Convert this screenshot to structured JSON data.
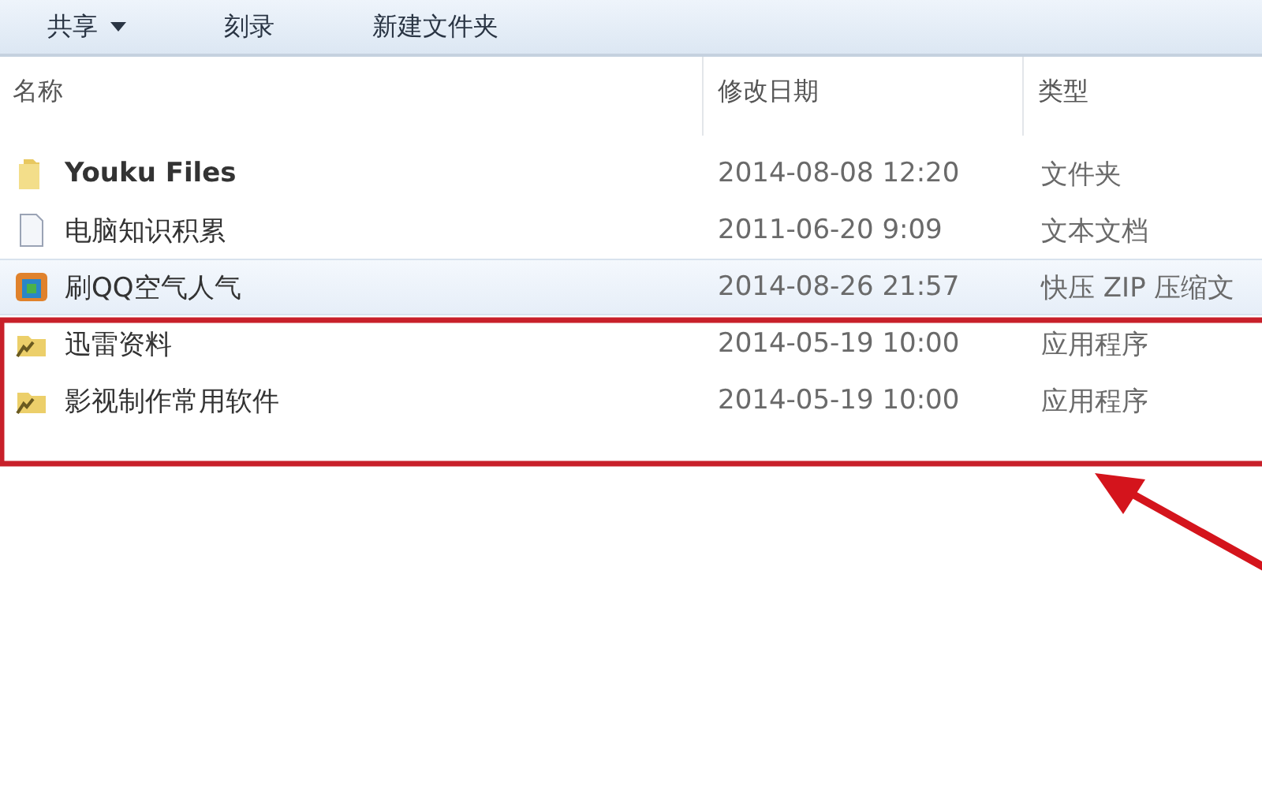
{
  "toolbar": [
    {
      "label": "共享",
      "has_menu": true
    },
    {
      "label": "刻录",
      "has_menu": false
    },
    {
      "label": "新建文件夹",
      "has_menu": false
    }
  ],
  "columns": [
    "名称",
    "修改日期",
    "类型"
  ],
  "rows": [
    {
      "kind": "folder",
      "name": "Youku Files",
      "date": "2014-08-08 12:20",
      "type": "文件夹",
      "selected": false
    },
    {
      "kind": "text",
      "name": "电脑知识积累",
      "date": "2011-06-20 9:09",
      "type": "文本文档",
      "selected": false
    },
    {
      "kind": "archive",
      "name": "刷QQ空气人气",
      "date": "2014-08-26 21:57",
      "type": "快压 ZIP 压缩文",
      "selected": true
    },
    {
      "kind": "shortcut",
      "name": "迅雷资料",
      "date": "2014-05-19 10:00",
      "type": "应用程序",
      "selected": false
    },
    {
      "kind": "shortcut",
      "name": "影视制作常用软件",
      "date": "2014-05-19 10:00",
      "type": "应用程序",
      "selected": false
    }
  ]
}
